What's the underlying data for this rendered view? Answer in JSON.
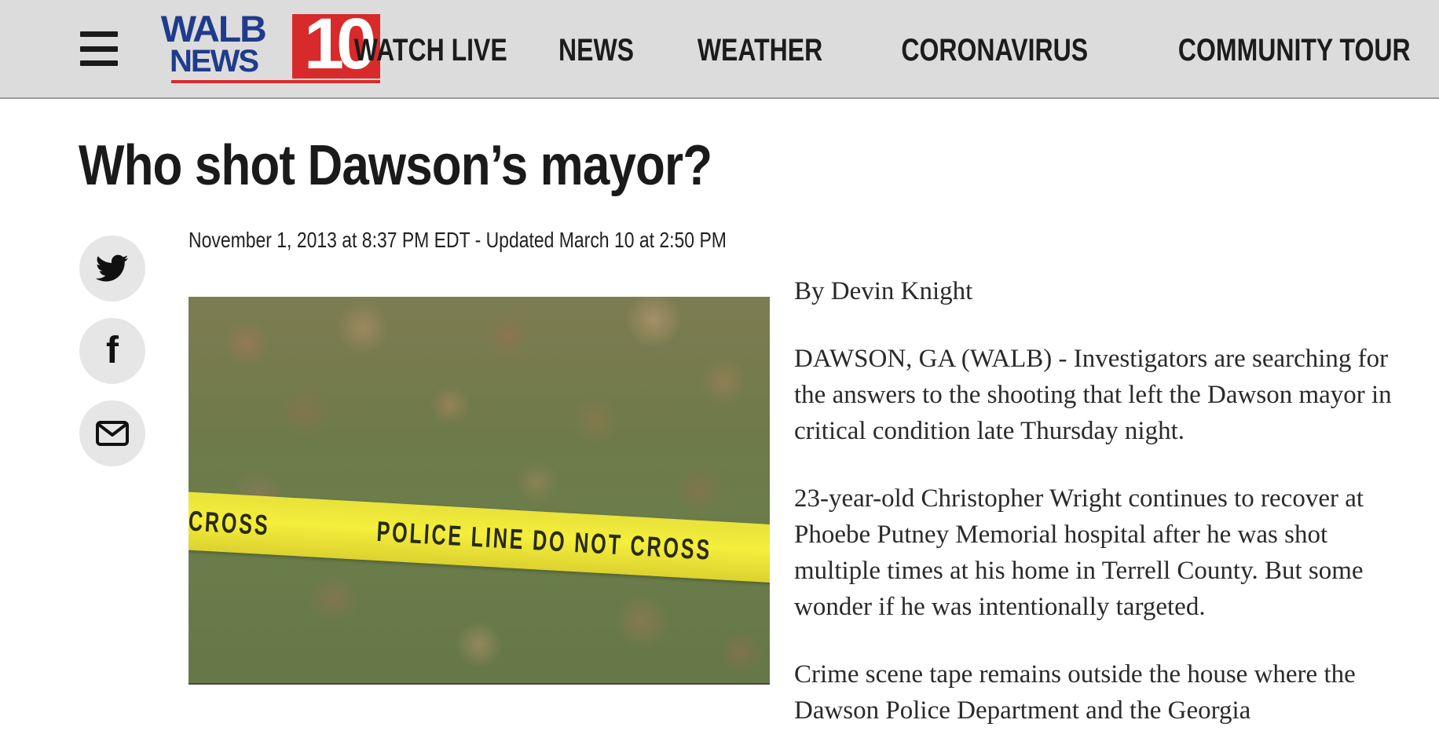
{
  "header": {
    "logo": {
      "brand_top": "WALB",
      "brand_bottom": "NEWS",
      "channel": "10"
    },
    "nav": [
      "WATCH LIVE",
      "NEWS",
      "WEATHER",
      "CORONAVIRUS",
      "COMMUNITY TOUR"
    ]
  },
  "article": {
    "headline": "Who shot Dawson’s mayor?",
    "dateline": "November 1, 2013 at 8:37 PM EDT - Updated March 10 at 2:50 PM",
    "byline": "By Devin Knight",
    "paragraphs": [
      "DAWSON, GA (WALB) - Investigators are searching for the answers to the shooting that left the Dawson mayor in critical condition late Thursday night.",
      "23-year-old Christopher Wright continues to recover at Phoebe Putney Memorial hospital after he was shot multiple times at his home in Terrell County. But some wonder if he was intentionally targeted.",
      "Crime scene tape remains outside the house where the Dawson Police Department and the Georgia"
    ]
  },
  "photo": {
    "tape_left": "CROSS",
    "tape_main": "POLICE LINE DO NOT CROSS"
  },
  "share": {
    "icons": [
      "twitter-icon",
      "facebook-icon",
      "email-icon"
    ],
    "facebook_glyph": "f"
  },
  "colors": {
    "header_bg": "#dcdcdc",
    "logo_blue": "#1f3b8c",
    "logo_red": "#d82a2a",
    "tape_yellow": "#f4ee3c"
  }
}
